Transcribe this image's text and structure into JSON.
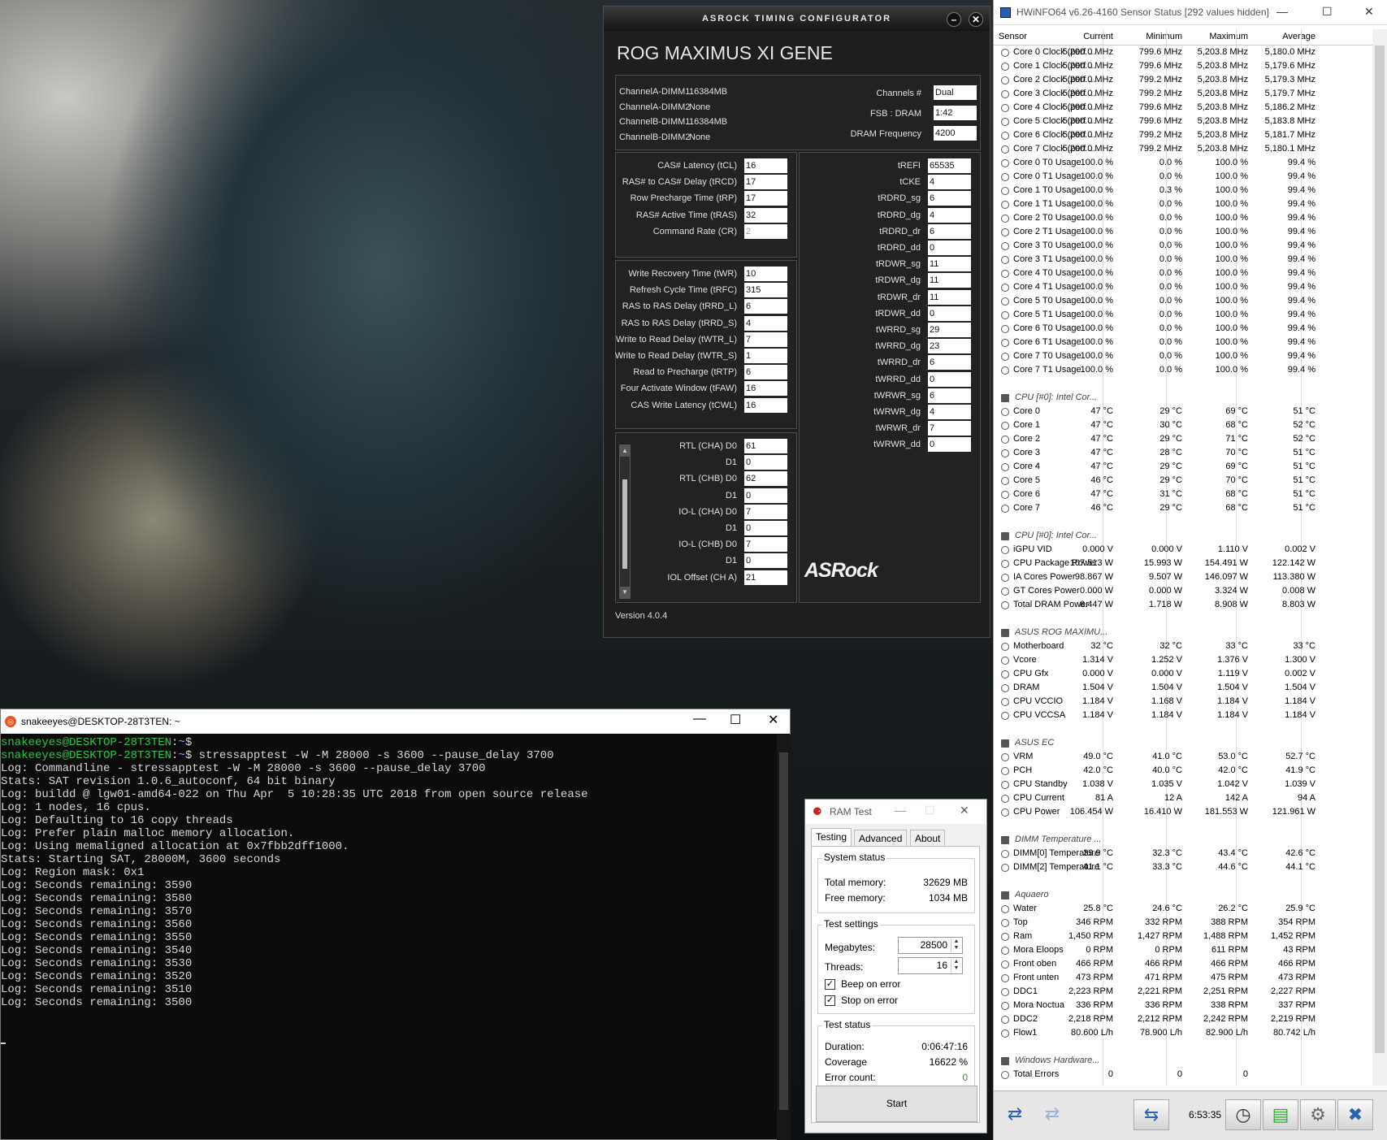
{
  "asrock": {
    "title": "ASRock Timing Configurator",
    "model": "ROG MAXIMUS XI GENE",
    "dimms": [
      {
        "label": "ChannelA-DIMM1",
        "value": "16384MB"
      },
      {
        "label": "ChannelA-DIMM2",
        "value": "None"
      },
      {
        "label": "ChannelB-DIMM1",
        "value": "16384MB"
      },
      {
        "label": "ChannelB-DIMM2",
        "value": "None"
      }
    ],
    "info": [
      {
        "label": "Channels #",
        "value": "Dual"
      },
      {
        "label": "FSB : DRAM",
        "value": "1:42"
      },
      {
        "label": "DRAM Frequency",
        "value": "4200"
      }
    ],
    "primary": [
      {
        "label": "CAS# Latency (tCL)",
        "value": "16"
      },
      {
        "label": "RAS# to CAS# Delay (tRCD)",
        "value": "17"
      },
      {
        "label": "Row Precharge Time (tRP)",
        "value": "17"
      },
      {
        "label": "RAS# Active Time (tRAS)",
        "value": "32"
      },
      {
        "label": "Command Rate (CR)",
        "value": "2"
      }
    ],
    "secondary": [
      {
        "label": "Write Recovery Time (tWR)",
        "value": "10"
      },
      {
        "label": "Refresh Cycle Time (tRFC)",
        "value": "315"
      },
      {
        "label": "RAS to RAS Delay (tRRD_L)",
        "value": "6"
      },
      {
        "label": "RAS to RAS Delay (tRRD_S)",
        "value": "4"
      },
      {
        "label": "Write to Read Delay (tWTR_L)",
        "value": "7"
      },
      {
        "label": "Write to Read Delay (tWTR_S)",
        "value": "1"
      },
      {
        "label": "Read to Precharge (tRTP)",
        "value": "6"
      },
      {
        "label": "Four Activate Window (tFAW)",
        "value": "16"
      },
      {
        "label": "CAS Write Latency (tCWL)",
        "value": "16"
      }
    ],
    "rtl": [
      {
        "label": "RTL (CHA) D0",
        "value": "61"
      },
      {
        "label": "D1",
        "value": "0"
      },
      {
        "label": "RTL (CHB) D0",
        "value": "62"
      },
      {
        "label": "D1",
        "value": "0"
      },
      {
        "label": "IO-L (CHA) D0",
        "value": "7"
      },
      {
        "label": "D1",
        "value": "0"
      },
      {
        "label": "IO-L (CHB) D0",
        "value": "7"
      },
      {
        "label": "D1",
        "value": "0"
      },
      {
        "label": "IOL Offset (CH A)",
        "value": "21"
      }
    ],
    "tertiary": [
      {
        "label": "tREFI",
        "value": "65535"
      },
      {
        "label": "tCKE",
        "value": "4"
      },
      {
        "label": "tRDRD_sg",
        "value": "6"
      },
      {
        "label": "tRDRD_dg",
        "value": "4"
      },
      {
        "label": "tRDRD_dr",
        "value": "6"
      },
      {
        "label": "tRDRD_dd",
        "value": "0"
      },
      {
        "label": "tRDWR_sg",
        "value": "11"
      },
      {
        "label": "tRDWR_dg",
        "value": "11"
      },
      {
        "label": "tRDWR_dr",
        "value": "11"
      },
      {
        "label": "tRDWR_dd",
        "value": "0"
      },
      {
        "label": "tWRRD_sg",
        "value": "29"
      },
      {
        "label": "tWRRD_dg",
        "value": "23"
      },
      {
        "label": "tWRRD_dr",
        "value": "6"
      },
      {
        "label": "tWRRD_dd",
        "value": "0"
      },
      {
        "label": "tWRWR_sg",
        "value": "6"
      },
      {
        "label": "tWRWR_dg",
        "value": "4"
      },
      {
        "label": "tWRWR_dr",
        "value": "7"
      },
      {
        "label": "tWRWR_dd",
        "value": "0"
      }
    ],
    "logo": "ASRock",
    "version": "Version 4.0.4"
  },
  "hwinfo": {
    "title": "HWiNFO64 v6.26-4160 Sensor Status [292 values hidden]",
    "columns": [
      "Sensor",
      "Current",
      "Minimum",
      "Maximum",
      "Average"
    ],
    "rows": [
      {
        "n": "Core 0 Clock (perf ...",
        "v": [
          "5,200.0 MHz",
          "799.6 MHz",
          "5,203.8 MHz",
          "5,180.0 MHz"
        ]
      },
      {
        "n": "Core 1 Clock (perf ...",
        "v": [
          "5,200.0 MHz",
          "799.6 MHz",
          "5,203.8 MHz",
          "5,179.6 MHz"
        ]
      },
      {
        "n": "Core 2 Clock (perf ...",
        "v": [
          "5,200.0 MHz",
          "799.2 MHz",
          "5,203.8 MHz",
          "5,179.3 MHz"
        ]
      },
      {
        "n": "Core 3 Clock (perf ...",
        "v": [
          "5,200.0 MHz",
          "799.2 MHz",
          "5,203.8 MHz",
          "5,179.7 MHz"
        ]
      },
      {
        "n": "Core 4 Clock (perf ...",
        "v": [
          "5,200.0 MHz",
          "799.6 MHz",
          "5,203.8 MHz",
          "5,186.2 MHz"
        ]
      },
      {
        "n": "Core 5 Clock (perf ...",
        "v": [
          "5,200.0 MHz",
          "799.6 MHz",
          "5,203.8 MHz",
          "5,183.8 MHz"
        ]
      },
      {
        "n": "Core 6 Clock (perf ...",
        "v": [
          "5,200.0 MHz",
          "799.2 MHz",
          "5,203.8 MHz",
          "5,181.7 MHz"
        ]
      },
      {
        "n": "Core 7 Clock (perf ...",
        "v": [
          "5,200.0 MHz",
          "799.2 MHz",
          "5,203.8 MHz",
          "5,180.1 MHz"
        ]
      },
      {
        "n": "Core 0 T0 Usage",
        "v": [
          "100.0 %",
          "0.0 %",
          "100.0 %",
          "99.4 %"
        ]
      },
      {
        "n": "Core 0 T1 Usage",
        "v": [
          "100.0 %",
          "0.0 %",
          "100.0 %",
          "99.4 %"
        ]
      },
      {
        "n": "Core 1 T0 Usage",
        "v": [
          "100.0 %",
          "0.3 %",
          "100.0 %",
          "99.4 %"
        ]
      },
      {
        "n": "Core 1 T1 Usage",
        "v": [
          "100.0 %",
          "0.0 %",
          "100.0 %",
          "99.4 %"
        ]
      },
      {
        "n": "Core 2 T0 Usage",
        "v": [
          "100.0 %",
          "0.0 %",
          "100.0 %",
          "99.4 %"
        ]
      },
      {
        "n": "Core 2 T1 Usage",
        "v": [
          "100.0 %",
          "0.0 %",
          "100.0 %",
          "99.4 %"
        ]
      },
      {
        "n": "Core 3 T0 Usage",
        "v": [
          "100.0 %",
          "0.0 %",
          "100.0 %",
          "99.4 %"
        ]
      },
      {
        "n": "Core 3 T1 Usage",
        "v": [
          "100.0 %",
          "0.0 %",
          "100.0 %",
          "99.4 %"
        ]
      },
      {
        "n": "Core 4 T0 Usage",
        "v": [
          "100.0 %",
          "0.0 %",
          "100.0 %",
          "99.4 %"
        ]
      },
      {
        "n": "Core 4 T1 Usage",
        "v": [
          "100.0 %",
          "0.0 %",
          "100.0 %",
          "99.4 %"
        ]
      },
      {
        "n": "Core 5 T0 Usage",
        "v": [
          "100.0 %",
          "0.0 %",
          "100.0 %",
          "99.4 %"
        ]
      },
      {
        "n": "Core 5 T1 Usage",
        "v": [
          "100.0 %",
          "0.0 %",
          "100.0 %",
          "99.4 %"
        ]
      },
      {
        "n": "Core 6 T0 Usage",
        "v": [
          "100.0 %",
          "0.0 %",
          "100.0 %",
          "99.4 %"
        ]
      },
      {
        "n": "Core 6 T1 Usage",
        "v": [
          "100.0 %",
          "0.0 %",
          "100.0 %",
          "99.4 %"
        ]
      },
      {
        "n": "Core 7 T0 Usage",
        "v": [
          "100.0 %",
          "0.0 %",
          "100.0 %",
          "99.4 %"
        ]
      },
      {
        "n": "Core 7 T1 Usage",
        "v": [
          "100.0 %",
          "0.0 %",
          "100.0 %",
          "99.4 %"
        ]
      },
      {
        "n": "",
        "v": [
          "",
          "",
          "",
          ""
        ]
      },
      {
        "g": true,
        "n": "CPU [#0]: Intel Cor...",
        "v": [
          "",
          "",
          "",
          ""
        ]
      },
      {
        "n": "Core 0",
        "v": [
          "47 °C",
          "29 °C",
          "69 °C",
          "51 °C"
        ]
      },
      {
        "n": "Core 1",
        "v": [
          "47 °C",
          "30 °C",
          "68 °C",
          "52 °C"
        ]
      },
      {
        "n": "Core 2",
        "v": [
          "47 °C",
          "29 °C",
          "71 °C",
          "52 °C"
        ]
      },
      {
        "n": "Core 3",
        "v": [
          "47 °C",
          "28 °C",
          "70 °C",
          "51 °C"
        ]
      },
      {
        "n": "Core 4",
        "v": [
          "47 °C",
          "29 °C",
          "69 °C",
          "51 °C"
        ]
      },
      {
        "n": "Core 5",
        "v": [
          "46 °C",
          "29 °C",
          "70 °C",
          "51 °C"
        ]
      },
      {
        "n": "Core 6",
        "v": [
          "47 °C",
          "31 °C",
          "68 °C",
          "51 °C"
        ]
      },
      {
        "n": "Core 7",
        "v": [
          "46 °C",
          "29 °C",
          "68 °C",
          "51 °C"
        ]
      },
      {
        "n": "",
        "v": [
          "",
          "",
          "",
          ""
        ]
      },
      {
        "g": true,
        "n": "CPU [#0]: Intel Cor...",
        "v": [
          "",
          "",
          "",
          ""
        ]
      },
      {
        "n": "iGPU VID",
        "v": [
          "0.000 V",
          "0.000 V",
          "1.110 V",
          "0.002 V"
        ]
      },
      {
        "n": "CPU Package Power",
        "v": [
          "107.513 W",
          "15.993 W",
          "154.491 W",
          "122.142 W"
        ]
      },
      {
        "n": "IA Cores Power",
        "v": [
          "98.867 W",
          "9.507 W",
          "146.097 W",
          "113.380 W"
        ]
      },
      {
        "n": "GT Cores Power",
        "v": [
          "0.000 W",
          "0.000 W",
          "3.324 W",
          "0.008 W"
        ]
      },
      {
        "n": "Total DRAM Power",
        "v": [
          "8.447 W",
          "1.718 W",
          "8.908 W",
          "8.803 W"
        ]
      },
      {
        "n": "",
        "v": [
          "",
          "",
          "",
          ""
        ]
      },
      {
        "g": true,
        "n": "ASUS ROG MAXIMU...",
        "v": [
          "",
          "",
          "",
          ""
        ]
      },
      {
        "n": "Motherboard",
        "v": [
          "32 °C",
          "32 °C",
          "33 °C",
          "33 °C"
        ]
      },
      {
        "n": "Vcore",
        "v": [
          "1.314 V",
          "1.252 V",
          "1.376 V",
          "1.300 V"
        ]
      },
      {
        "n": "CPU Gfx",
        "v": [
          "0.000 V",
          "0.000 V",
          "1.119 V",
          "0.002 V"
        ]
      },
      {
        "n": "DRAM",
        "v": [
          "1.504 V",
          "1.504 V",
          "1.504 V",
          "1.504 V"
        ]
      },
      {
        "n": "CPU VCCIO",
        "v": [
          "1.184 V",
          "1.168 V",
          "1.184 V",
          "1.184 V"
        ]
      },
      {
        "n": "CPU VCCSA",
        "v": [
          "1.184 V",
          "1.184 V",
          "1.184 V",
          "1.184 V"
        ]
      },
      {
        "n": "",
        "v": [
          "",
          "",
          "",
          ""
        ]
      },
      {
        "g": true,
        "n": "ASUS EC",
        "v": [
          "",
          "",
          "",
          ""
        ]
      },
      {
        "n": "VRM",
        "v": [
          "49.0 °C",
          "41.0 °C",
          "53.0 °C",
          "52.7 °C"
        ]
      },
      {
        "n": "PCH",
        "v": [
          "42.0 °C",
          "40.0 °C",
          "42.0 °C",
          "41.9 °C"
        ]
      },
      {
        "n": "CPU Standby",
        "v": [
          "1.038 V",
          "1.035 V",
          "1.042 V",
          "1.039 V"
        ]
      },
      {
        "n": "CPU Current",
        "v": [
          "81 A",
          "12 A",
          "142 A",
          "94 A"
        ]
      },
      {
        "n": "CPU Power",
        "v": [
          "106.454 W",
          "16.410 W",
          "181.553 W",
          "121.961 W"
        ]
      },
      {
        "n": "",
        "v": [
          "",
          "",
          "",
          ""
        ]
      },
      {
        "g": true,
        "n": "DIMM Temperature ...",
        "v": [
          "",
          "",
          "",
          ""
        ]
      },
      {
        "n": "DIMM[0] Temperature",
        "v": [
          "39.9 °C",
          "32.3 °C",
          "43.4 °C",
          "42.6 °C"
        ]
      },
      {
        "n": "DIMM[2] Temperature",
        "v": [
          "41.1 °C",
          "33.3 °C",
          "44.6 °C",
          "44.1 °C"
        ]
      },
      {
        "n": "",
        "v": [
          "",
          "",
          "",
          ""
        ]
      },
      {
        "g": true,
        "n": "Aquaero",
        "v": [
          "",
          "",
          "",
          ""
        ]
      },
      {
        "n": "Water",
        "v": [
          "25.8 °C",
          "24.6 °C",
          "26.2 °C",
          "25.9 °C"
        ]
      },
      {
        "n": "Top",
        "v": [
          "346 RPM",
          "332 RPM",
          "388 RPM",
          "354 RPM"
        ]
      },
      {
        "n": "Ram",
        "v": [
          "1,450 RPM",
          "1,427 RPM",
          "1,488 RPM",
          "1,452 RPM"
        ]
      },
      {
        "n": "Mora Eloops",
        "v": [
          "0 RPM",
          "0 RPM",
          "611 RPM",
          "43 RPM"
        ]
      },
      {
        "n": "Front oben",
        "v": [
          "466 RPM",
          "466 RPM",
          "466 RPM",
          "466 RPM"
        ]
      },
      {
        "n": "Front unten",
        "v": [
          "473 RPM",
          "471 RPM",
          "475 RPM",
          "473 RPM"
        ]
      },
      {
        "n": "DDC1",
        "v": [
          "2,223 RPM",
          "2,221 RPM",
          "2,251 RPM",
          "2,227 RPM"
        ]
      },
      {
        "n": "Mora Noctua",
        "v": [
          "336 RPM",
          "336 RPM",
          "338 RPM",
          "337 RPM"
        ]
      },
      {
        "n": "DDC2",
        "v": [
          "2,218 RPM",
          "2,212 RPM",
          "2,242 RPM",
          "2,219 RPM"
        ]
      },
      {
        "n": "Flow1",
        "v": [
          "80.600 L/h",
          "78.900 L/h",
          "82.900 L/h",
          "80.742 L/h"
        ]
      },
      {
        "n": "",
        "v": [
          "",
          "",
          "",
          ""
        ]
      },
      {
        "g": true,
        "n": "Windows Hardware...",
        "v": [
          "",
          "",
          "",
          ""
        ]
      },
      {
        "n": "Total Errors",
        "v": [
          "0",
          "0",
          "0",
          ""
        ]
      }
    ],
    "time": "6:53:35"
  },
  "terminal": {
    "title": "snakeeyes@DESKTOP-28T3TEN: ~",
    "prompt_user": "snakeeyes@DESKTOP-28T3TEN",
    "prompt_path": "~",
    "command": "stressapptest -W -M 28000 -s 3600 --pause_delay 3700",
    "lines": [
      "Log: Commandline - stressapptest -W -M 28000 -s 3600 --pause_delay 3700",
      "Stats: SAT revision 1.0.6_autoconf, 64 bit binary",
      "Log: buildd @ lgw01-amd64-022 on Thu Apr  5 10:28:35 UTC 2018 from open source release",
      "Log: 1 nodes, 16 cpus.",
      "Log: Defaulting to 16 copy threads",
      "Log: Prefer plain malloc memory allocation.",
      "Log: Using memaligned allocation at 0x7fbb2dff1000.",
      "Stats: Starting SAT, 28000M, 3600 seconds",
      "Log: Region mask: 0x1",
      "Log: Seconds remaining: 3590",
      "Log: Seconds remaining: 3580",
      "Log: Seconds remaining: 3570",
      "Log: Seconds remaining: 3560",
      "Log: Seconds remaining: 3550",
      "Log: Seconds remaining: 3540",
      "Log: Seconds remaining: 3530",
      "Log: Seconds remaining: 3520",
      "Log: Seconds remaining: 3510",
      "Log: Seconds remaining: 3500"
    ]
  },
  "ramtest": {
    "title": "RAM Test",
    "tabs": [
      "Testing",
      "Advanced",
      "About"
    ],
    "system_status": "System status",
    "total_memory_label": "Total memory:",
    "total_memory": "32629 MB",
    "free_memory_label": "Free memory:",
    "free_memory": "1034 MB",
    "test_settings": "Test settings",
    "megabytes_label": "Megabytes:",
    "megabytes": "28500",
    "threads_label": "Threads:",
    "threads": "16",
    "beep_label": "Beep on error",
    "beep_checked": true,
    "stop_label": "Stop on error",
    "stop_checked": true,
    "test_status": "Test status",
    "duration_label": "Duration:",
    "duration": "0:06:47:16",
    "coverage_label": "Coverage",
    "coverage": "16622 %",
    "errors_label": "Error count:",
    "errors": "0",
    "start_label": "Start",
    "error_color": "#2a9a2a"
  }
}
